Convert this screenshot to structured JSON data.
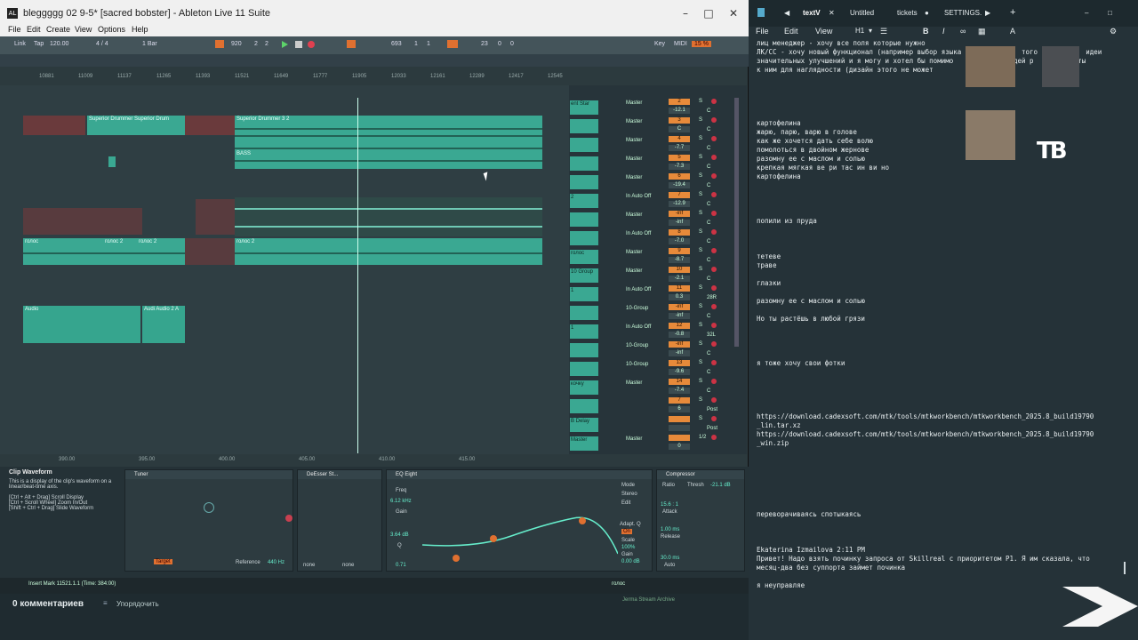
{
  "ableton": {
    "title": "bleggggg 02 9-5* [sacred bobster] - Ableton Live 11 Suite",
    "menu": [
      "File",
      "Edit",
      "Create",
      "View",
      "Options",
      "Help"
    ],
    "transport": {
      "link": "Link",
      "tap": "Tap",
      "tempo": "120.00",
      "sig": "4 / 4",
      "quant": "1 Bar",
      "pos1": "920",
      "pos2": "2",
      "pos3": "2",
      "pos4": "693",
      "pos5": "1",
      "pos6": "1",
      "pos7": "23",
      "pos8": "0",
      "pos9": "0",
      "key": "Key",
      "midi": "MIDI",
      "cpu": "15 %"
    },
    "ruler": [
      "10881",
      "11009",
      "11137",
      "11265",
      "11393",
      "11521",
      "11649",
      "11777",
      "11905",
      "12033",
      "12161",
      "12289",
      "12417",
      "12545"
    ],
    "clips": {
      "c1": "Superior Drummer",
      "c2": "Superior Drum",
      "c3": "Superior Drummer 3 2",
      "c4": "BASS",
      "c5": "голос",
      "c6": "голос 2",
      "c7": "голос 2",
      "c8": "голос 2",
      "c9": "Audio",
      "c10": "Audi Audio 2 A"
    },
    "mixer_rows": [
      {
        "name": "ent Star",
        "out": "Master",
        "vol": "2",
        "pan": "-12.1",
        "s": "S",
        "c": "C"
      },
      {
        "name": "",
        "out": "Master",
        "vol": "3",
        "pan": "C",
        "s": "S",
        "c": "C"
      },
      {
        "name": "",
        "out": "Master",
        "vol": "4",
        "pan": "-7.7",
        "s": "S",
        "c": "C"
      },
      {
        "name": "",
        "out": "Master",
        "vol": "5",
        "pan": "-7.3",
        "s": "S",
        "c": "C"
      },
      {
        "name": "",
        "out": "Master",
        "vol": "6",
        "pan": "-19.4",
        "s": "S",
        "c": "C"
      },
      {
        "name": "2",
        "out": "In Auto Off",
        "vol": "7",
        "pan": "-12.9",
        "s": "S",
        "c": "C"
      },
      {
        "name": "",
        "out": "Master",
        "vol": "-inf",
        "pan": "-inf",
        "s": "S",
        "c": "C"
      },
      {
        "name": "",
        "out": "In Auto Off",
        "vol": "8",
        "pan": "-7.0",
        "s": "S",
        "c": "C"
      },
      {
        "name": "голос",
        "out": "Master",
        "vol": "9",
        "pan": "-8.7",
        "s": "S",
        "c": "C"
      },
      {
        "name": "10 Group",
        "out": "Master",
        "vol": "10",
        "pan": "-2.1",
        "s": "S",
        "c": "C"
      },
      {
        "name": "1",
        "out": "In Auto Off",
        "vol": "11",
        "pan": "0.3",
        "s": "S",
        "c": "28R"
      },
      {
        "name": "",
        "out": "10-Group",
        "vol": "-inf",
        "pan": "-inf",
        "s": "S",
        "c": "C"
      },
      {
        "name": "1",
        "out": "In Auto Off",
        "vol": "12",
        "pan": "-0.8",
        "s": "S",
        "c": "32L"
      },
      {
        "name": "",
        "out": "10-Group",
        "vol": "-inf",
        "pan": "-inf",
        "s": "S",
        "c": "C"
      },
      {
        "name": "",
        "out": "10-Group",
        "vol": "13",
        "pan": "-9.6",
        "s": "S",
        "c": "C"
      },
      {
        "name": "кочку",
        "out": "Master",
        "vol": "14",
        "pan": "-7.4",
        "s": "S",
        "c": "C"
      },
      {
        "name": "",
        "out": "",
        "vol": "7",
        "pan": "6",
        "s": "S",
        "c": "Post"
      },
      {
        "name": "B Delay",
        "out": "",
        "vol": "",
        "pan": "",
        "s": "S",
        "c": "Post"
      },
      {
        "name": "Master",
        "out": "Master",
        "vol": "",
        "pan": "0",
        "s": "1/2",
        "c": ""
      }
    ],
    "bottom_ruler": [
      "390.00",
      "395.00",
      "400.00",
      "405.00",
      "410.00",
      "415.00"
    ],
    "info": {
      "title": "Clip Waveform",
      "l1": "This is a display of the clip's waveform on a linear/beat-time axis.",
      "l2": "[Ctrl + Alt + Drag] Scroll Display",
      "l3": "[Ctrl + Scroll Wheel] Zoom In/Out",
      "l4": "[Shift + Ctrl + Drag] Slide Waveform"
    },
    "devices": {
      "tuner": "Tuner",
      "tuner_target": "Target",
      "tuner_ref": "Reference",
      "tuner_hz": "440 Hz",
      "deesser": "DeEsser St...",
      "none1": "none",
      "none2": "none",
      "eq": "EQ Eight",
      "freq": "Freq",
      "freq_val": "6.12 kHz",
      "gain": "Gain",
      "gain_val": "3.64 dB",
      "q": "Q",
      "q_val": "0.71",
      "mode": "Mode",
      "mode_val": "Stereo",
      "edit": "Edit",
      "adapt": "Adapt. Q",
      "adapt_val": "On",
      "scale": "Scale",
      "scale_val": "100%",
      "gain2": "Gain",
      "gain2_val": "0.00 dB",
      "comp": "Compressor",
      "thresh": "Thresh",
      "thresh_val": "-21.1 dB",
      "ratio": "Ratio",
      "ratio_val": "15.6 : 1",
      "attack": "Attack",
      "attack_val": "1.00 ms",
      "release": "Release",
      "release_val": "30.0 ms",
      "auto": "Auto"
    },
    "status": "Insert Mark 11521.1.1 (Time: 384:00)",
    "track_sel": "голос",
    "comments": "0 комментариев",
    "sort": "Упорядочить",
    "archive": "Jerma Stream Archive"
  },
  "notepad": {
    "tabs": [
      "textV",
      "Untitled",
      "tickets",
      "SETTINGS."
    ],
    "menu": [
      "File",
      "Edit",
      "View",
      "H1"
    ],
    "lines": [
      "лиц менеджер - хочу все поля которые нужно",
      "ЛК/СС - хочу новый функционал (например выбор языка               того есть/б     идеи",
      "значительных улучшений и я могу и хотел бы помимо           их идей р   ать макеты",
      "к ним для наглядности (дизайн этого не может",
      "",
      "",
      "",
      "",
      "",
      "картофелина",
      "жарю, парю, варю в голове",
      "как же хочется дать себе волю",
      "помолоться в двойном жернове",
      "разомну ее с маслом и солью",
      "крепкая мягкая ве ри тас ин ви но",
      "картофелина",
      "",
      "",
      "",
      "",
      "попили из пруда",
      "",
      "",
      "",
      "тетеве",
      "траве",
      "",
      "глазки",
      "",
      "разомну ее с маслом и солью",
      "",
      "Но ты растёшь в любой грязи",
      "",
      "",
      "",
      "",
      "я тоже хочу свои фотки",
      "",
      "",
      "",
      "",
      "",
      "https://download.cadexsoft.com/mtk/tools/mtkworkbench/mtkworkbench_2025.8_build19790",
      "_lin.tar.xz",
      "https://download.cadexsoft.com/mtk/tools/mtkworkbench/mtkworkbench_2025.8_build19790",
      "_win.zip",
      "",
      "",
      "",
      "",
      "",
      "",
      "",
      "переворачиваясь спотыкаясь",
      "",
      "",
      "",
      "Ekaterina Izmailova 2:11 PM",
      "Привет! Надо взять починку запроса от Skillreal с приоритетом P1. Я им сказала, что",
      "месяц-два без суппорта займет починка",
      "",
      "я неуправляе"
    ],
    "logo": "TB"
  }
}
